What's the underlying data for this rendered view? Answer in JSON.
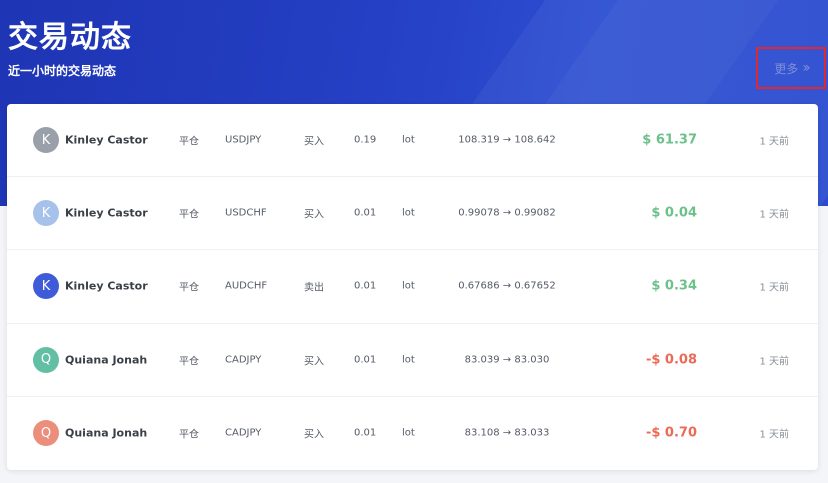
{
  "header": {
    "title": "交易动态",
    "subtitle": "近一小时的交易动态",
    "more_label": "更多",
    "more_icon": "double-chevron-right-icon"
  },
  "colors": {
    "header_bg": "#2540c4",
    "profit_positive": "#6cc18a",
    "profit_negative": "#ec6a55",
    "highlight_border": "#e0282e"
  },
  "trades": [
    {
      "initial": "K",
      "avatar_color": "#9aa0aa",
      "name": "Kinley Castor",
      "status": "平仓",
      "symbol": "USDJPY",
      "side": "买入",
      "volume": "0.19",
      "unit": "lot",
      "prices": "108.319 → 108.642",
      "profit": "$ 61.37",
      "profit_sign": "pos",
      "time": "1 天前"
    },
    {
      "initial": "K",
      "avatar_color": "#a7c2ea",
      "name": "Kinley Castor",
      "status": "平仓",
      "symbol": "USDCHF",
      "side": "买入",
      "volume": "0.01",
      "unit": "lot",
      "prices": "0.99078 → 0.99082",
      "profit": "$ 0.04",
      "profit_sign": "pos",
      "time": "1 天前"
    },
    {
      "initial": "K",
      "avatar_color": "#3f5bd8",
      "name": "Kinley Castor",
      "status": "平仓",
      "symbol": "AUDCHF",
      "side": "卖出",
      "volume": "0.01",
      "unit": "lot",
      "prices": "0.67686 → 0.67652",
      "profit": "$ 0.34",
      "profit_sign": "pos",
      "time": "1 天前"
    },
    {
      "initial": "Q",
      "avatar_color": "#63bfa3",
      "name": "Quiana Jonah",
      "status": "平仓",
      "symbol": "CADJPY",
      "side": "买入",
      "volume": "0.01",
      "unit": "lot",
      "prices": "83.039 → 83.030",
      "profit": "-$ 0.08",
      "profit_sign": "neg",
      "time": "1 天前"
    },
    {
      "initial": "Q",
      "avatar_color": "#ec8e7c",
      "name": "Quiana Jonah",
      "status": "平仓",
      "symbol": "CADJPY",
      "side": "买入",
      "volume": "0.01",
      "unit": "lot",
      "prices": "83.108 → 83.033",
      "profit": "-$ 0.70",
      "profit_sign": "neg",
      "time": "1 天前"
    }
  ]
}
